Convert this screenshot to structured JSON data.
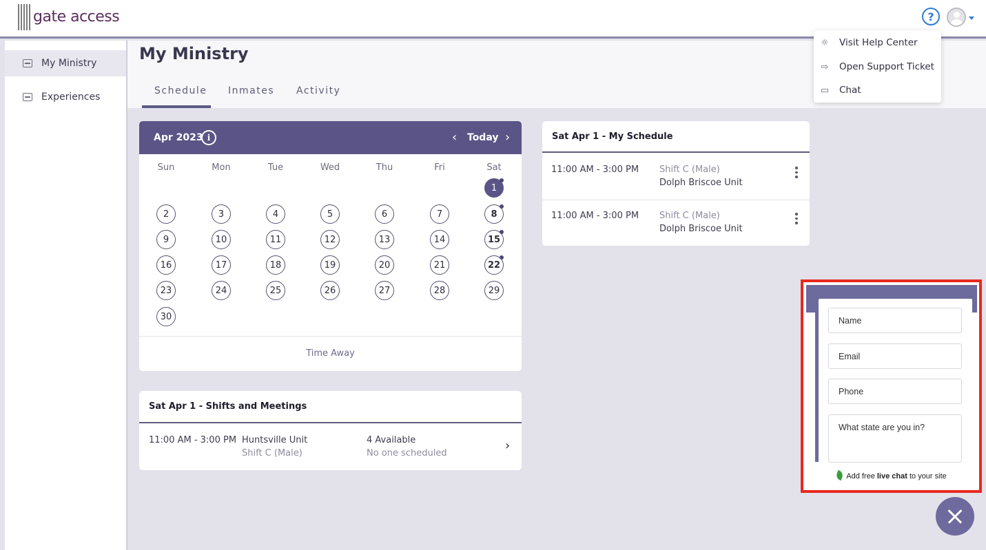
{
  "app": {
    "logo_text": "gate access"
  },
  "sidebar": {
    "items": [
      {
        "label": "My Ministry",
        "icon": "briefcase-icon",
        "active": true
      },
      {
        "label": "Experiences",
        "icon": "newspaper-icon",
        "active": false
      }
    ]
  },
  "page": {
    "title": "My Ministry",
    "tabs": [
      {
        "label": "Schedule",
        "active": true
      },
      {
        "label": "Inmates",
        "active": false
      },
      {
        "label": "Activity",
        "active": false
      }
    ]
  },
  "calendar": {
    "month_label": "Apr 2023",
    "today_label": "Today",
    "weekdays": [
      "Sun",
      "Mon",
      "Tue",
      "Wed",
      "Thu",
      "Fri",
      "Sat"
    ],
    "selected_day": 1,
    "days_with_events": [
      1,
      8,
      15,
      22
    ],
    "bold_days": [
      8,
      15,
      22
    ],
    "time_away_label": "Time Away",
    "accent_color": "#5b5487"
  },
  "shifts": {
    "title": "Sat Apr 1 - Shifts and Meetings",
    "rows": [
      {
        "time": "11:00 AM - 3:00 PM",
        "unit": "Huntsville Unit",
        "shift": "Shift C (Male)",
        "available": "4 Available",
        "scheduled": "No one scheduled"
      }
    ]
  },
  "my_schedule": {
    "title": "Sat Apr 1 - My Schedule",
    "rows": [
      {
        "time": "11:00 AM - 3:00 PM",
        "shift": "Shift C (Male)",
        "unit": "Dolph Briscoe Unit"
      },
      {
        "time": "11:00 AM - 3:00 PM",
        "shift": "Shift C (Male)",
        "unit": "Dolph Briscoe Unit"
      }
    ]
  },
  "help_menu": {
    "items": [
      {
        "label": "Visit Help Center",
        "icon": "lightbulb-icon"
      },
      {
        "label": "Open Support Ticket",
        "icon": "ticket-icon"
      },
      {
        "label": "Chat",
        "icon": "chat-icon"
      }
    ]
  },
  "chat_widget": {
    "fields": [
      "Name",
      "Email",
      "Phone",
      "What state are you in?"
    ],
    "footer_prefix": "Add free ",
    "footer_bold": "live chat",
    "footer_suffix": " to your site",
    "highlight_color": "#e8281e"
  }
}
